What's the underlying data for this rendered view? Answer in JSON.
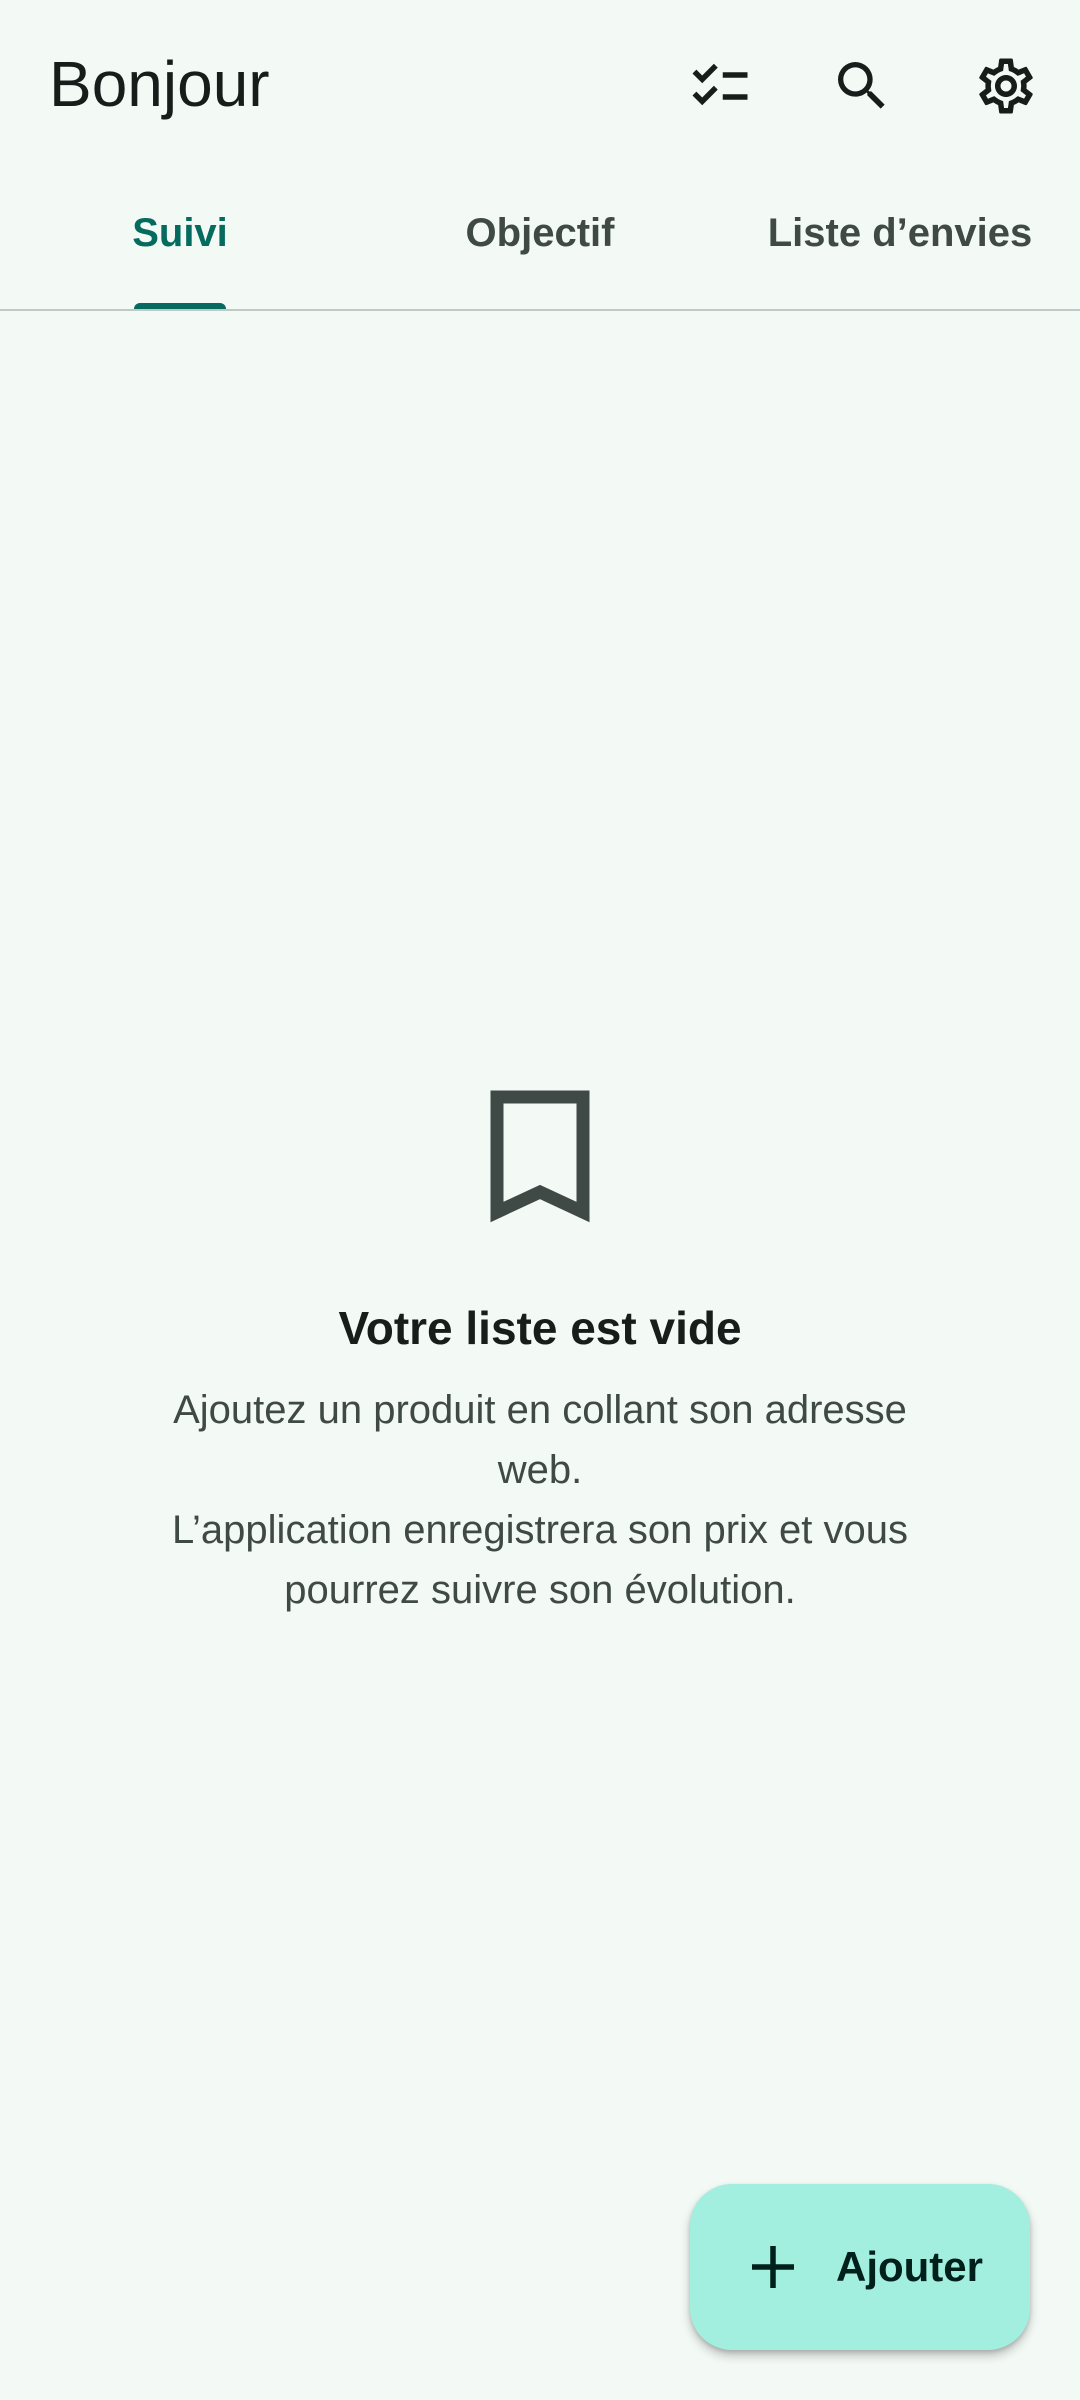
{
  "header": {
    "title": "Bonjour",
    "actions": [
      {
        "icon": "checklist-icon"
      },
      {
        "icon": "search-icon"
      },
      {
        "icon": "gear-icon"
      }
    ]
  },
  "tabs": [
    {
      "label": "Suivi",
      "active": true
    },
    {
      "label": "Objectif",
      "active": false
    },
    {
      "label": "Liste d’envies",
      "active": false
    }
  ],
  "empty_state": {
    "icon": "bookmark-icon",
    "title": "Votre liste est vide",
    "text": "Ajoutez un produit en collant son adresse web.\nL’application enregistrera son prix et vous pourrez suivre son évolution."
  },
  "fab": {
    "icon": "plus-icon",
    "label": "Ajouter"
  },
  "colors": {
    "background": "#f3f9f5",
    "accent": "#046b5e",
    "fab_background": "#a2efdf",
    "text_primary": "#161d1b",
    "text_secondary": "#3f4946"
  }
}
